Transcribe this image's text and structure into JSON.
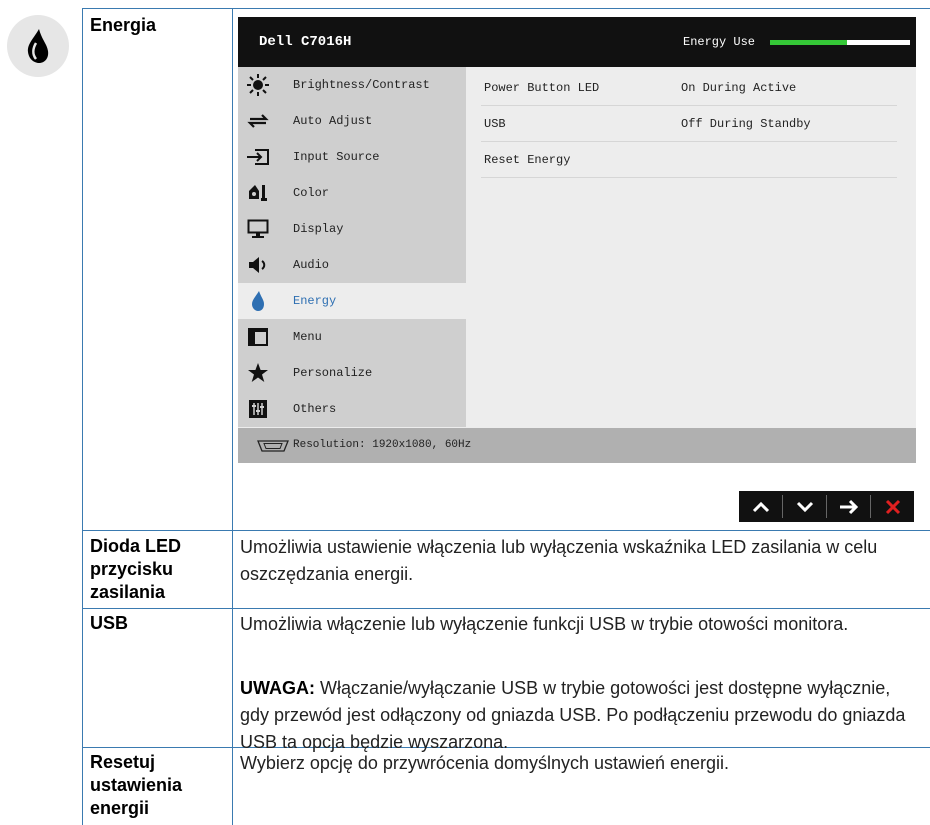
{
  "section": {
    "title": "Energia"
  },
  "osd": {
    "model": "Dell C7016H",
    "energy_use_label": "Energy Use",
    "energy_use_level": 0.55,
    "menu": [
      {
        "label": "Brightness/Contrast",
        "icon": "sun-icon"
      },
      {
        "label": "Auto Adjust",
        "icon": "auto-adjust-icon"
      },
      {
        "label": "Input Source",
        "icon": "input-source-icon"
      },
      {
        "label": "Color",
        "icon": "color-icon"
      },
      {
        "label": "Display",
        "icon": "monitor-icon"
      },
      {
        "label": "Audio",
        "icon": "speaker-icon"
      },
      {
        "label": "Energy",
        "icon": "drop-icon",
        "active": true
      },
      {
        "label": "Menu",
        "icon": "menu-icon"
      },
      {
        "label": "Personalize",
        "icon": "star-icon"
      },
      {
        "label": "Others",
        "icon": "others-icon"
      }
    ],
    "settings": [
      {
        "name": "Power Button LED",
        "value": "On During Active"
      },
      {
        "name": "USB",
        "value": "Off During Standby"
      },
      {
        "name": "Reset Energy",
        "value": ""
      }
    ],
    "resolution": "Resolution: 1920x1080, 60Hz"
  },
  "rows": [
    {
      "term": "Dioda LED przycisku zasilania",
      "desc": "Umożliwia ustawienie włączenia lub wyłączenia wskaźnika LED zasilania w celu oszczędzania energii."
    },
    {
      "term": "USB",
      "desc": "Umożliwia włączenie lub wyłączenie funkcji USB w trybie otowości monitora.",
      "note_label": "UWAGA:",
      "note": " Włączanie/wyłączanie USB w trybie gotowości jest dostępne wyłącznie, gdy przewód jest odłączony od gniazda USB. Po podłączeniu przewodu do gniazda USB ta opcja będzie wyszarzona."
    },
    {
      "term": "Resetuj ustawienia energii",
      "desc": "Wybierz opcję do przywrócenia domyślnych ustawień energii."
    }
  ],
  "colors": {
    "accent": "#2e6fb2",
    "grid": "#3a7ab0",
    "energy_bar": "#35c837",
    "close": "#e02020"
  }
}
